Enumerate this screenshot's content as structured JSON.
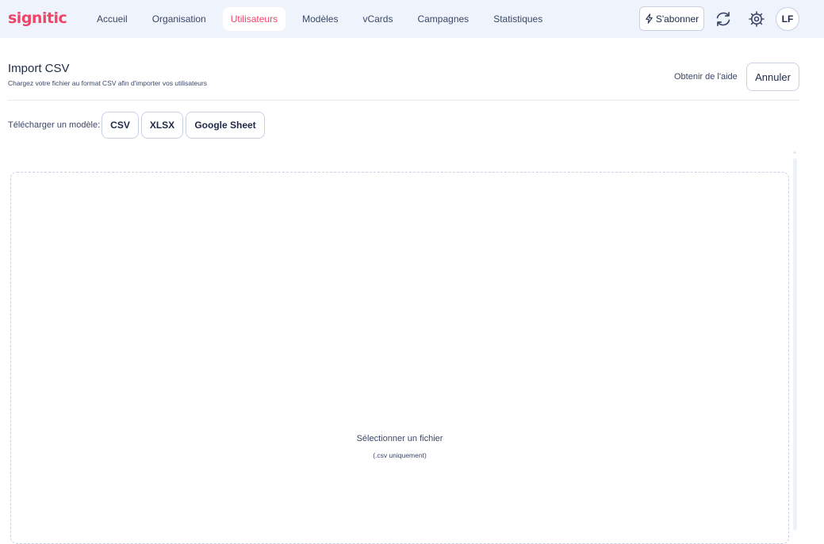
{
  "app": {
    "logo": "signitic"
  },
  "nav": {
    "items": [
      {
        "label": "Accueil"
      },
      {
        "label": "Organisation"
      },
      {
        "label": "Utilisateurs",
        "active": true
      },
      {
        "label": "Modèles"
      },
      {
        "label": "vCards"
      },
      {
        "label": "Campagnes"
      },
      {
        "label": "Statistiques"
      }
    ]
  },
  "header_actions": {
    "subscribe_label": "S'abonner",
    "avatar_initials": "LF",
    "icons": [
      "bolt-icon",
      "sync-icon",
      "gear-icon"
    ]
  },
  "page": {
    "title": "Import CSV",
    "subtitle": "Chargez votre fichier au format CSV afin d'importer vos utilisateurs",
    "help_label": "Obtenir de l'aide",
    "cancel_label": "Annuler"
  },
  "templates": {
    "label": "Télécharger un modèle:",
    "buttons": [
      {
        "label": "CSV"
      },
      {
        "label": "XLSX"
      },
      {
        "label": "Google Sheet"
      }
    ]
  },
  "dropzone": {
    "title": "Sélectionner un fichier",
    "hint": "(.csv uniquement)"
  },
  "colors": {
    "brand": "#ef4569",
    "topbar_bg": "#eff3fb",
    "text": "#2a3450",
    "border": "#c9d1e2"
  }
}
